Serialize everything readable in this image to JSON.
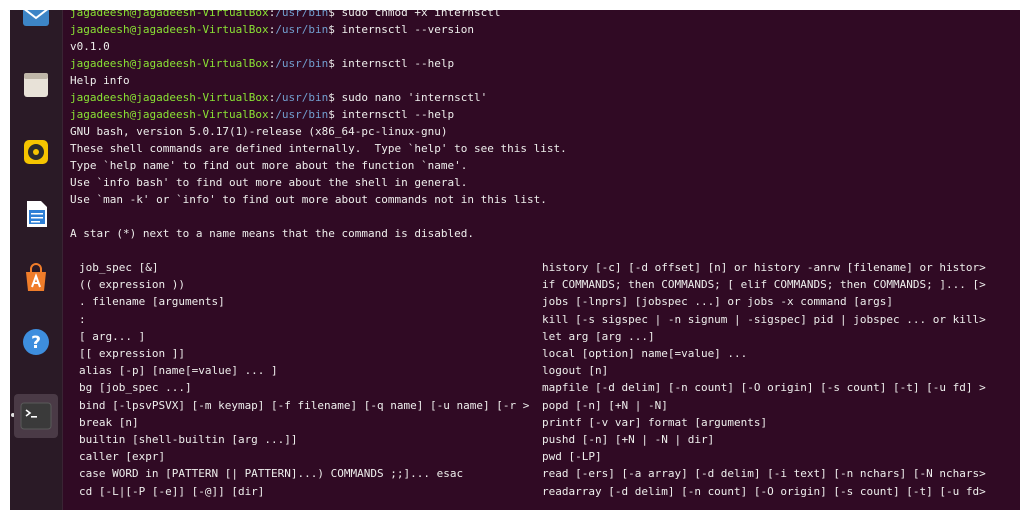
{
  "prompt": {
    "user_host": "jagadeesh@jagadeesh-VirtualBox",
    "colon": ":",
    "path": "/usr/bin",
    "symbol": "$ "
  },
  "session": {
    "cmd1": "sudo chmod +x internsctl",
    "cmd2": "internsctl --version",
    "out_version": "v0.1.0",
    "cmd3": "internsctl --help",
    "out_help": "Help info",
    "cmd4": "sudo nano 'internsctl'",
    "cmd5": "internsctl --help",
    "bash_info": [
      "GNU bash, version 5.0.17(1)-release (x86_64-pc-linux-gnu)",
      "These shell commands are defined internally.  Type `help' to see this list.",
      "Type `help name' to find out more about the function `name'.",
      "Use `info bash' to find out more about the shell in general.",
      "Use `man -k' or `info' to find out more about commands not in this list.",
      "",
      "A star (*) next to a name means that the command is disabled."
    ]
  },
  "builtins_left": [
    "job_spec [&]",
    "(( expression ))",
    ". filename [arguments]",
    ":",
    "[ arg... ]",
    "[[ expression ]]",
    "alias [-p] [name[=value] ... ]",
    "bg [job_spec ...]",
    "bind [-lpsvPSVX] [-m keymap] [-f filename] [-q name] [-u name] [-r >",
    "break [n]",
    "builtin [shell-builtin [arg ...]]",
    "caller [expr]",
    "case WORD in [PATTERN [| PATTERN]...) COMMANDS ;;]... esac",
    "cd [-L|[-P [-e]] [-@]] [dir]"
  ],
  "builtins_right": [
    "history [-c] [-d offset] [n] or history -anrw [filename] or histor>",
    "if COMMANDS; then COMMANDS; [ elif COMMANDS; then COMMANDS; ]... [>",
    "jobs [-lnprs] [jobspec ...] or jobs -x command [args]",
    "kill [-s sigspec | -n signum | -sigspec] pid | jobspec ... or kill>",
    "let arg [arg ...]",
    "local [option] name[=value] ...",
    "logout [n]",
    "mapfile [-d delim] [-n count] [-O origin] [-s count] [-t] [-u fd] >",
    "popd [-n] [+N | -N]",
    "printf [-v var] format [arguments]",
    "pushd [-n] [+N | -N | dir]",
    "pwd [-LP]",
    "read [-ers] [-a array] [-d delim] [-i text] [-n nchars] [-N nchars>",
    "readarray [-d delim] [-n count] [-O origin] [-s count] [-t] [-u fd>"
  ],
  "dock": {
    "items": [
      {
        "name": "thunderbird-icon",
        "color": "#3d85c6"
      },
      {
        "name": "files-icon",
        "color": "#e8e2d8"
      },
      {
        "name": "rhythmbox-icon",
        "color": "#f5c400"
      },
      {
        "name": "libreoffice-writer-icon",
        "color": "#2e7fd6"
      },
      {
        "name": "software-center-icon",
        "color": "#f07d2a"
      },
      {
        "name": "help-icon",
        "color": "#3e8ede"
      },
      {
        "name": "terminal-icon",
        "color": "#3a3a3a"
      }
    ]
  },
  "colors": {
    "background": "#300a24",
    "user_host": "#8ae234",
    "path": "#729fcf",
    "text": "#eeeeec"
  }
}
